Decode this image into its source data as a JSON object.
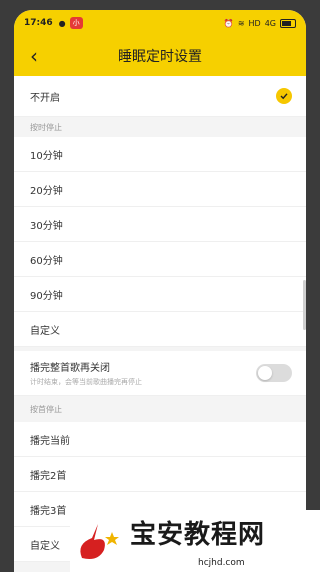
{
  "status_bar": {
    "time": "17:46",
    "notification_badge": "小",
    "right_indicators": "HD",
    "network": "4G"
  },
  "navbar": {
    "back_label": "‹",
    "title": "睡眠定时设置"
  },
  "options": {
    "off_label": "不开启",
    "section_by_time": "按时停止",
    "time_items": [
      "10分钟",
      "20分钟",
      "30分钟",
      "60分钟",
      "90分钟",
      "自定义"
    ],
    "finish_song_title": "播完整首歌再关闭",
    "finish_song_desc": "计时结束，会等当前歌曲播完再停止",
    "finish_song_enabled": false,
    "section_by_song": "按首停止",
    "song_items": [
      "播完当前",
      "播完2首",
      "播完3首",
      "自定义"
    ]
  },
  "colors": {
    "accent": "#f6d000",
    "check": "#f6c700"
  },
  "watermark": {
    "text_cn": "宝安教程网",
    "text_en": "hcjhd.com"
  }
}
